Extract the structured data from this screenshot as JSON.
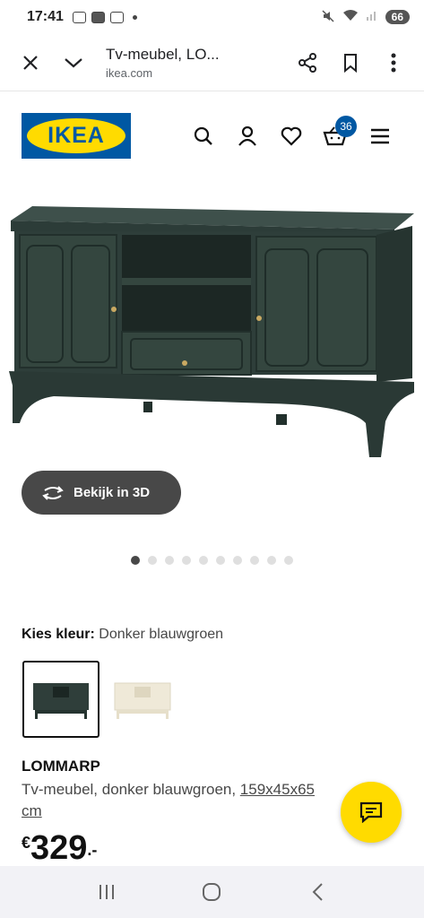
{
  "status_bar": {
    "time": "17:41",
    "battery": "66"
  },
  "browser": {
    "title": "Tv-meubel, LO...",
    "url": "ikea.com",
    "icons": [
      "close-icon",
      "chevron-down-icon",
      "share-icon",
      "bookmark-icon",
      "more-vert-icon"
    ]
  },
  "header": {
    "logo_text": "IKEA",
    "cart_count": "36",
    "icons": [
      "search-icon",
      "user-icon",
      "heart-icon",
      "cart-icon",
      "menu-icon"
    ],
    "brand_colors": {
      "blue": "#0058a3",
      "yellow": "#ffdb00"
    }
  },
  "gallery": {
    "view_3d_label": "Bekijk in 3D",
    "dot_count": 10,
    "active_dot": 0
  },
  "color_picker": {
    "label": "Kies kleur:",
    "selected_value": "Donker blauwgroen",
    "options": [
      {
        "name": "Donker blauwgroen",
        "color": "#2f3e3a",
        "selected": true
      },
      {
        "name": "Wit",
        "color": "#efe9d8",
        "selected": false
      }
    ]
  },
  "product": {
    "name": "LOMMARP",
    "description": "Tv-meubel, donker blauwgroen, ",
    "size_link": "159x45x65",
    "size_unit": "cm",
    "price_currency": "€",
    "price_integer": "329",
    "price_decimal": ".-"
  },
  "system_nav": {
    "icons": [
      "recents-icon",
      "home-icon",
      "back-icon"
    ]
  }
}
